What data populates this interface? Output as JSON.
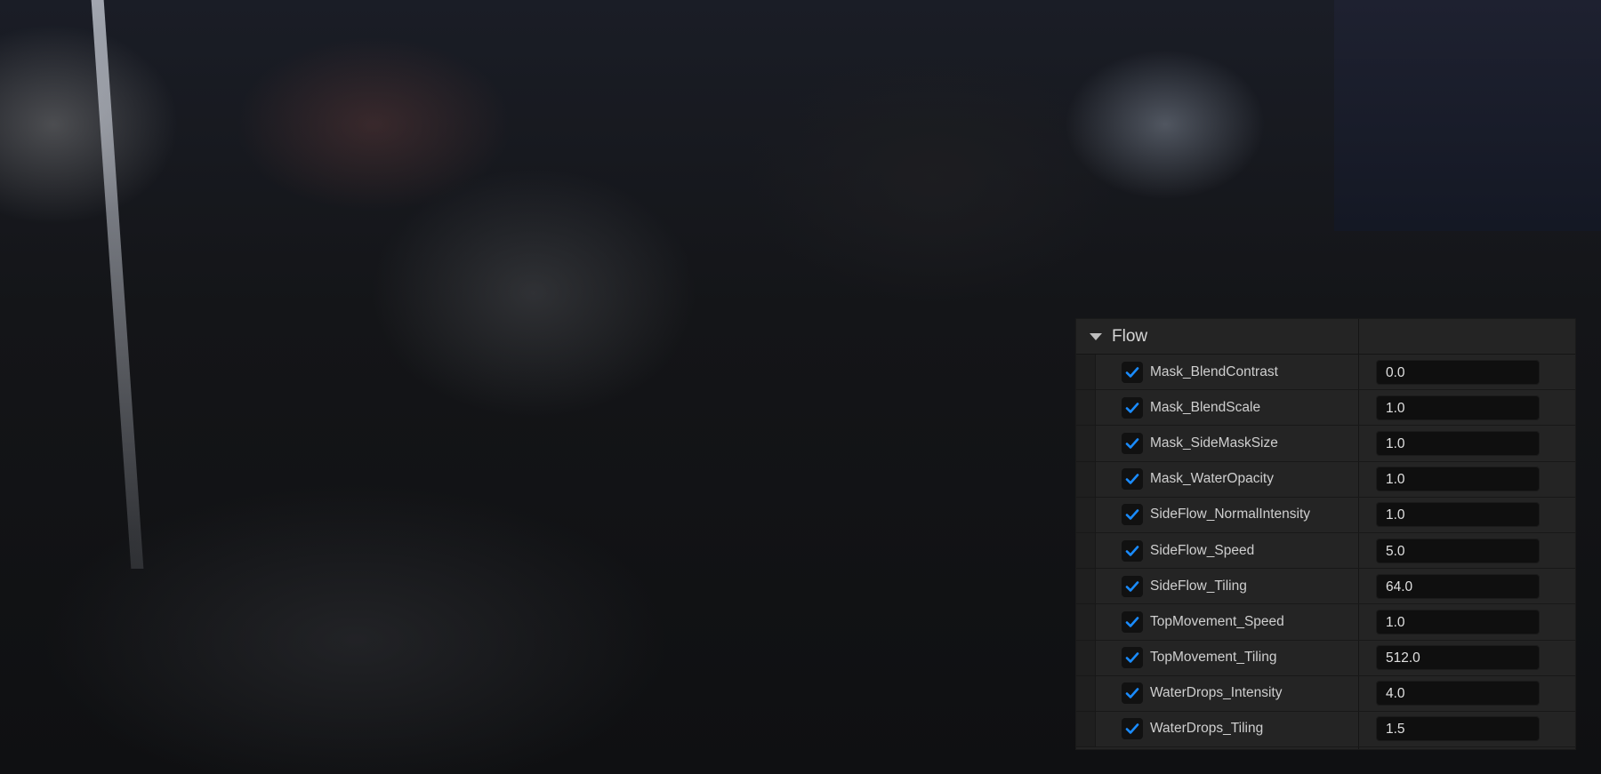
{
  "panel": {
    "title": "Flow",
    "accent": "#1a8cff",
    "rows": [
      {
        "label": "Mask_BlendContrast",
        "value": "0.0",
        "checked": true
      },
      {
        "label": "Mask_BlendScale",
        "value": "1.0",
        "checked": true
      },
      {
        "label": "Mask_SideMaskSize",
        "value": "1.0",
        "checked": true
      },
      {
        "label": "Mask_WaterOpacity",
        "value": "1.0",
        "checked": true
      },
      {
        "label": "SideFlow_NormalIntensity",
        "value": "1.0",
        "checked": true
      },
      {
        "label": "SideFlow_Speed",
        "value": "5.0",
        "checked": true
      },
      {
        "label": "SideFlow_Tiling",
        "value": "64.0",
        "checked": true
      },
      {
        "label": "TopMovement_Speed",
        "value": "1.0",
        "checked": true
      },
      {
        "label": "TopMovement_Tiling",
        "value": "512.0",
        "checked": true
      },
      {
        "label": "WaterDrops_Intensity",
        "value": "4.0",
        "checked": true
      },
      {
        "label": "WaterDrops_Tiling",
        "value": "1.5",
        "checked": true
      }
    ]
  }
}
